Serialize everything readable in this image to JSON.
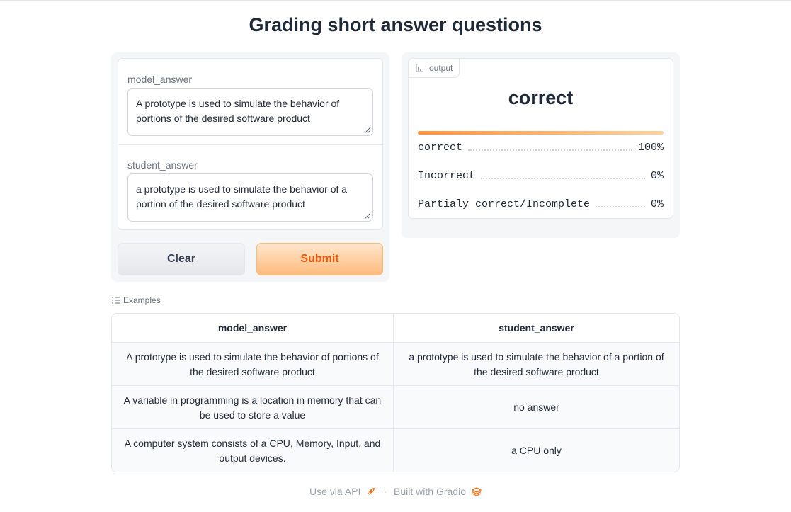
{
  "page": {
    "title": "Grading short answer questions"
  },
  "inputs": {
    "model_answer": {
      "label": "model_answer",
      "value": "A prototype is used to simulate the behavior of portions of the desired software product"
    },
    "student_answer": {
      "label": "student_answer",
      "value": "a prototype is used to simulate the behavior of a portion of the desired software product"
    }
  },
  "buttons": {
    "clear_label": "Clear",
    "submit_label": "Submit"
  },
  "output": {
    "tab_label": "output",
    "tab_icon": "bar-chart-icon",
    "prediction": "correct",
    "top_confidence": 1.0,
    "confidences": [
      {
        "label": "correct",
        "value": "100%"
      },
      {
        "label": "Incorrect",
        "value": "0%"
      },
      {
        "label": "Partialy correct/Incomplete",
        "value": "0%"
      }
    ]
  },
  "examples": {
    "label": "Examples",
    "headers": [
      "model_answer",
      "student_answer"
    ],
    "rows": [
      [
        "A prototype is used to simulate the behavior of portions of the desired software product",
        "a prototype is used to simulate the behavior of a portion of the desired software product"
      ],
      [
        "A variable in programming is a location in memory that can be used to store a value",
        "no answer"
      ],
      [
        "A computer system consists of a CPU, Memory, Input, and output devices.",
        "a CPU only"
      ]
    ]
  },
  "footer": {
    "api_label": "Use via API",
    "separator": "·",
    "built_label": "Built with Gradio"
  },
  "colors": {
    "accent": "#f97316",
    "submit_text": "#ea580c"
  }
}
